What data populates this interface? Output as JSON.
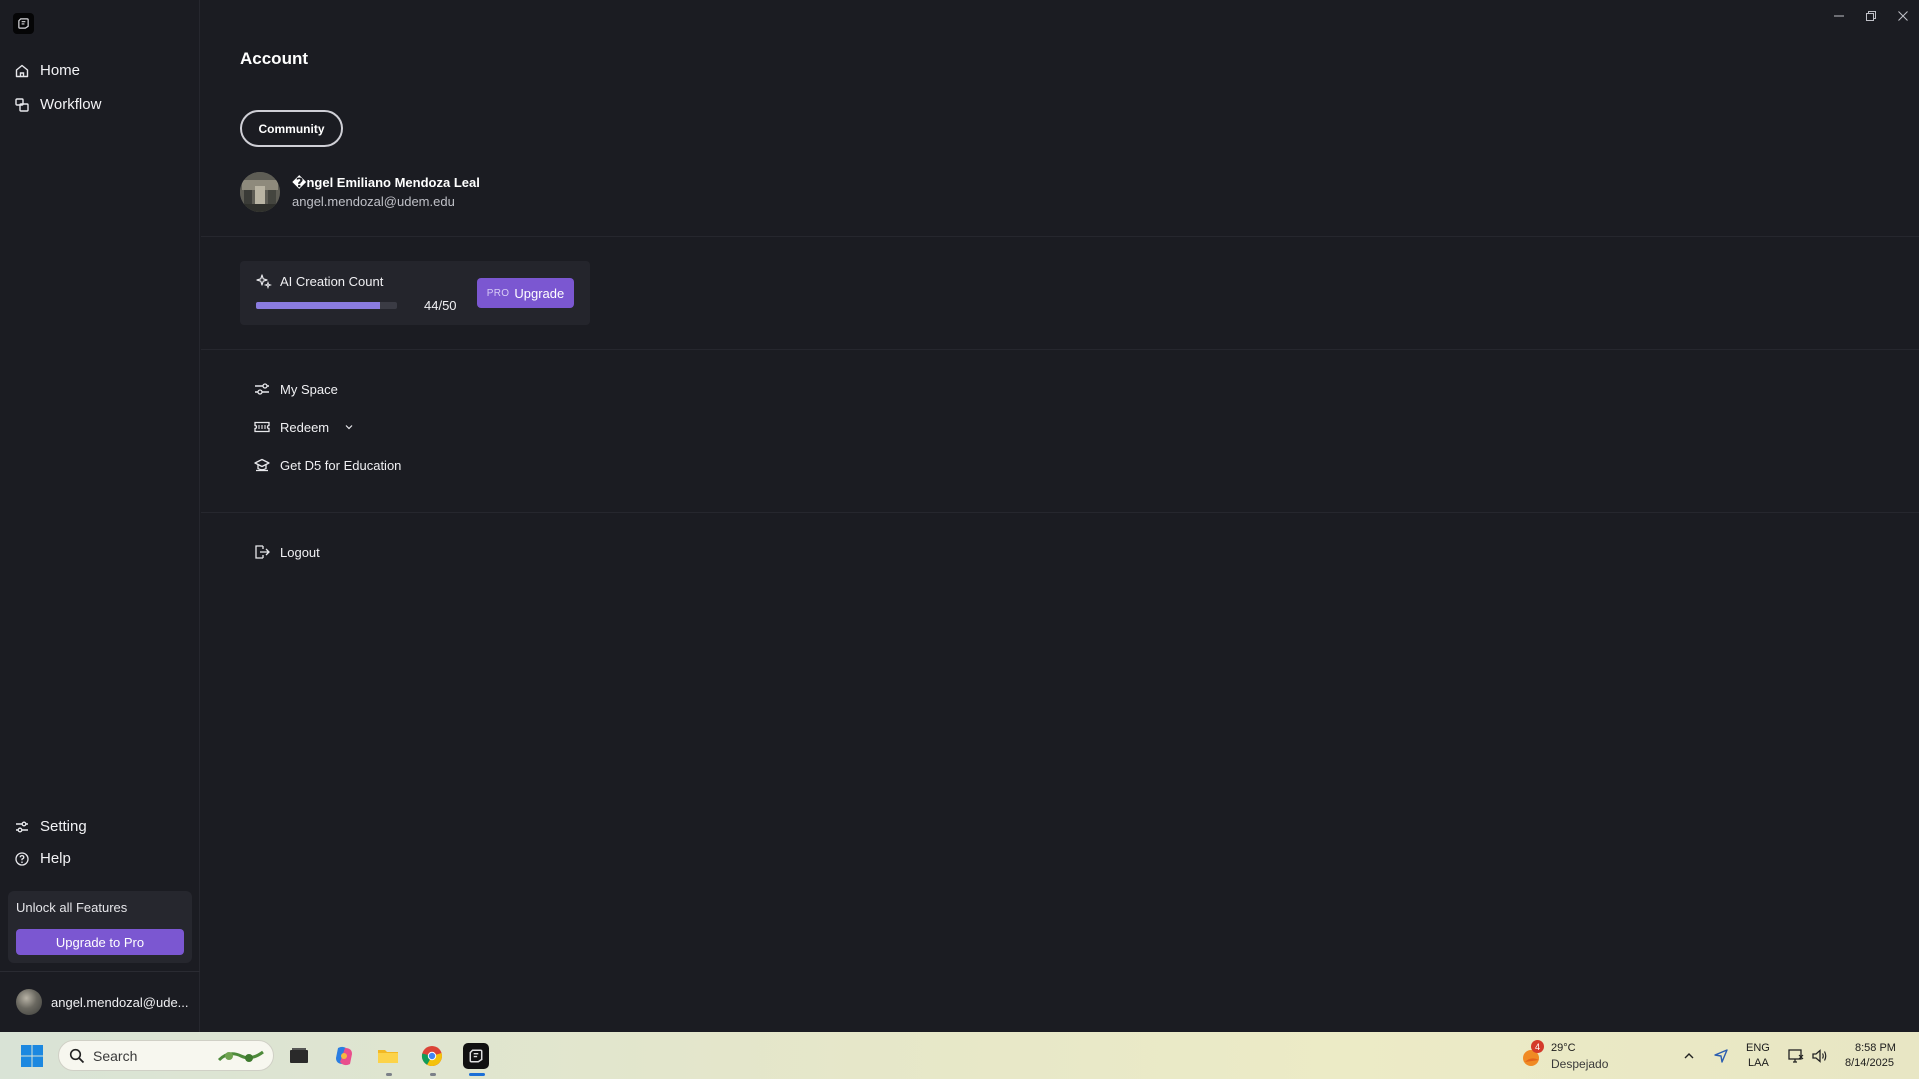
{
  "sidebar": {
    "nav": [
      {
        "label": "Home",
        "icon": "home-icon"
      },
      {
        "label": "Workflow",
        "icon": "workflow-icon"
      }
    ],
    "bottom_nav": [
      {
        "label": "Setting",
        "icon": "sliders-icon"
      },
      {
        "label": "Help",
        "icon": "help-circle-icon"
      }
    ],
    "unlock_card": {
      "text": "Unlock all Features",
      "button": "Upgrade to Pro"
    },
    "user_label": "angel.mendozal@ude..."
  },
  "main": {
    "title": "Account",
    "plan_badge": "Community",
    "user": {
      "name": "�ngel Emiliano Mendoza Leal",
      "email": "angel.mendozal@udem.edu"
    },
    "ai_card": {
      "title": "AI Creation Count",
      "count": "44/50",
      "used": 44,
      "limit": 50,
      "pro_tag": "PRO",
      "upgrade_label": "Upgrade"
    },
    "menu": [
      {
        "label": "My Space",
        "icon": "sliders-icon"
      },
      {
        "label": "Redeem",
        "icon": "ticket-icon"
      },
      {
        "label": "Get D5 for Education",
        "icon": "education-icon"
      }
    ],
    "logout_label": "Logout"
  },
  "taskbar": {
    "search_placeholder": "Search",
    "weather": {
      "temp": "29°C",
      "condition": "Despejado",
      "badge": "4"
    },
    "lang": {
      "primary": "ENG",
      "secondary": "LAA"
    },
    "time": "8:58 PM",
    "date": "8/14/2025"
  },
  "colors": {
    "background": "#1b1c22",
    "accent": "#7b57d1",
    "progress": "#8a7be0"
  }
}
